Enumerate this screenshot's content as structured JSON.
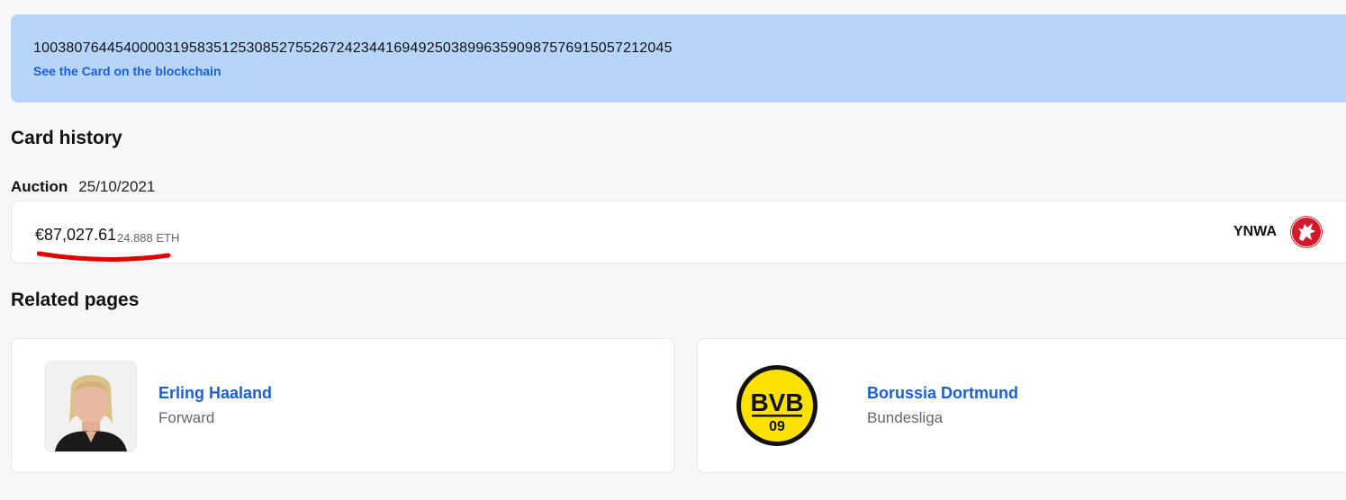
{
  "token": {
    "id": "1003807644540000319583512530852755267242344169492503899635909875769150572120​45",
    "blockchain_link": "See the Card on the blockchain"
  },
  "history": {
    "title": "Card history",
    "entries": [
      {
        "type": "Auction",
        "date": "25/10/2021",
        "price_eur": "€87,027.61",
        "price_eth": "24.888 ETH",
        "buyer": "YNWA",
        "buyer_avatar_icon": "liverbird-icon"
      }
    ]
  },
  "related": {
    "title": "Related pages",
    "items": [
      {
        "name": "Erling Haaland",
        "subtitle": "Forward",
        "image_icon": "player-photo"
      },
      {
        "name": "Borussia Dortmund",
        "subtitle": "Bundesliga",
        "image_icon": "bvb-logo-icon"
      }
    ]
  },
  "colors": {
    "accent": "#1b5fd8",
    "token_box": "#b7d4f9",
    "annotation_red": "#e00000",
    "bvb_yellow": "#fde100"
  }
}
